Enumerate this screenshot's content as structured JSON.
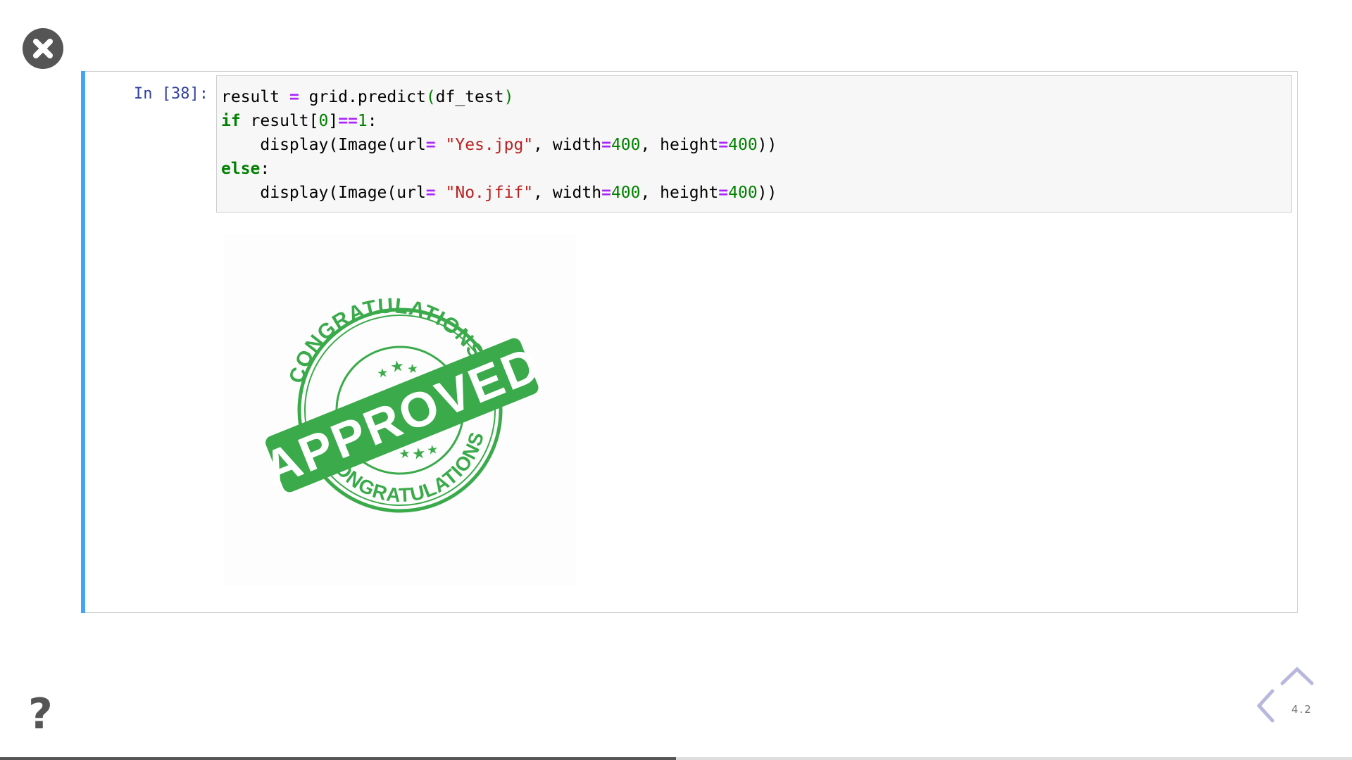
{
  "controls": {
    "close_icon": "close-icon",
    "help_label": "?",
    "help_icon": "question-mark-icon",
    "nav_up_icon": "chevron-up-icon",
    "nav_left_icon": "chevron-left-icon",
    "slide_number": "4.2"
  },
  "cell": {
    "prompt": "In [38]:",
    "code_lines": [
      [
        {
          "t": "result "
        },
        {
          "t": "=",
          "c": "op"
        },
        {
          "t": " grid.predict"
        },
        {
          "t": "(",
          "c": "paren"
        },
        {
          "t": "df_test"
        },
        {
          "t": ")",
          "c": "paren"
        }
      ],
      [
        {
          "t": "if",
          "c": "kw"
        },
        {
          "t": " result[",
          "c": ""
        },
        {
          "t": "0",
          "c": "num"
        },
        {
          "t": "]"
        },
        {
          "t": "==",
          "c": "op"
        },
        {
          "t": "1",
          "c": "num"
        },
        {
          "t": ":"
        }
      ],
      [
        {
          "t": "    display(Image(url"
        },
        {
          "t": "=",
          "c": "op"
        },
        {
          "t": " "
        },
        {
          "t": "\"Yes.jpg\"",
          "c": "str"
        },
        {
          "t": ", width"
        },
        {
          "t": "=",
          "c": "op"
        },
        {
          "t": "400",
          "c": "num"
        },
        {
          "t": ", height"
        },
        {
          "t": "=",
          "c": "op"
        },
        {
          "t": "400",
          "c": "num"
        },
        {
          "t": "))"
        }
      ],
      [
        {
          "t": "else",
          "c": "kw"
        },
        {
          "t": ":"
        }
      ],
      [
        {
          "t": "    display(Image(url"
        },
        {
          "t": "=",
          "c": "op"
        },
        {
          "t": " "
        },
        {
          "t": "\"No.jfif\"",
          "c": "str"
        },
        {
          "t": ", width"
        },
        {
          "t": "=",
          "c": "op"
        },
        {
          "t": "400",
          "c": "num"
        },
        {
          "t": ", height"
        },
        {
          "t": "=",
          "c": "op"
        },
        {
          "t": "400",
          "c": "num"
        },
        {
          "t": "))"
        }
      ]
    ],
    "output": {
      "stamp_top_text": "CONGRATULATIONS",
      "stamp_bottom_text": "CONGRATULATIONS",
      "stamp_banner_text": "APPROVED",
      "stamp_color": "#3aaa4a"
    }
  },
  "colors": {
    "cell_accent": "#42a5f5",
    "prompt": "#303f9f"
  },
  "progress": {
    "fraction": 0.5
  }
}
